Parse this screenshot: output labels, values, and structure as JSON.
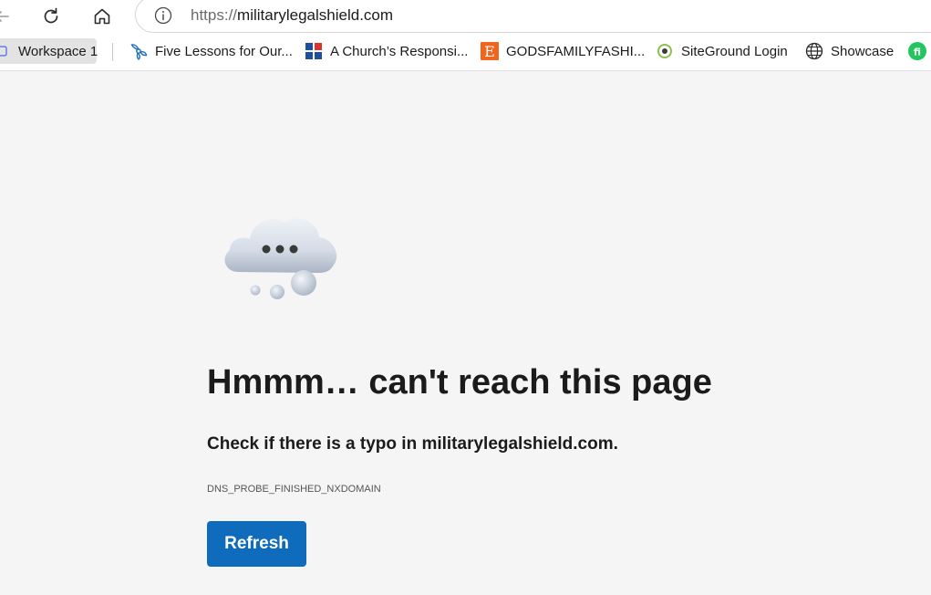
{
  "browser": {
    "address": {
      "scheme": "https://",
      "host": "militarylegalshield.com"
    },
    "bookmarks": [
      {
        "label": "Workspace 1",
        "icon": "workspace-icon"
      },
      {
        "label": "Five Lessons for Our...",
        "icon": "tripod-logo-icon"
      },
      {
        "label": "A Church’s Responsi...",
        "icon": "grid-logo-icon"
      },
      {
        "label": "GODSFAMILYFASHI...",
        "icon": "etsy-e-icon"
      },
      {
        "label": "SiteGround Login",
        "icon": "siteground-icon"
      },
      {
        "label": "Showcase",
        "icon": "globe-icon"
      },
      {
        "label": "",
        "icon": "fi-logo-icon"
      }
    ]
  },
  "error_page": {
    "headline": "Hmmm… can't reach this page",
    "hint": "Check if there is a typo in militarylegalshield.com.",
    "error_code": "DNS_PROBE_FINISHED_NXDOMAIN",
    "refresh_label": "Refresh"
  },
  "colors": {
    "accent": "#0f6cbd",
    "page_background": "#f5f5f5"
  }
}
